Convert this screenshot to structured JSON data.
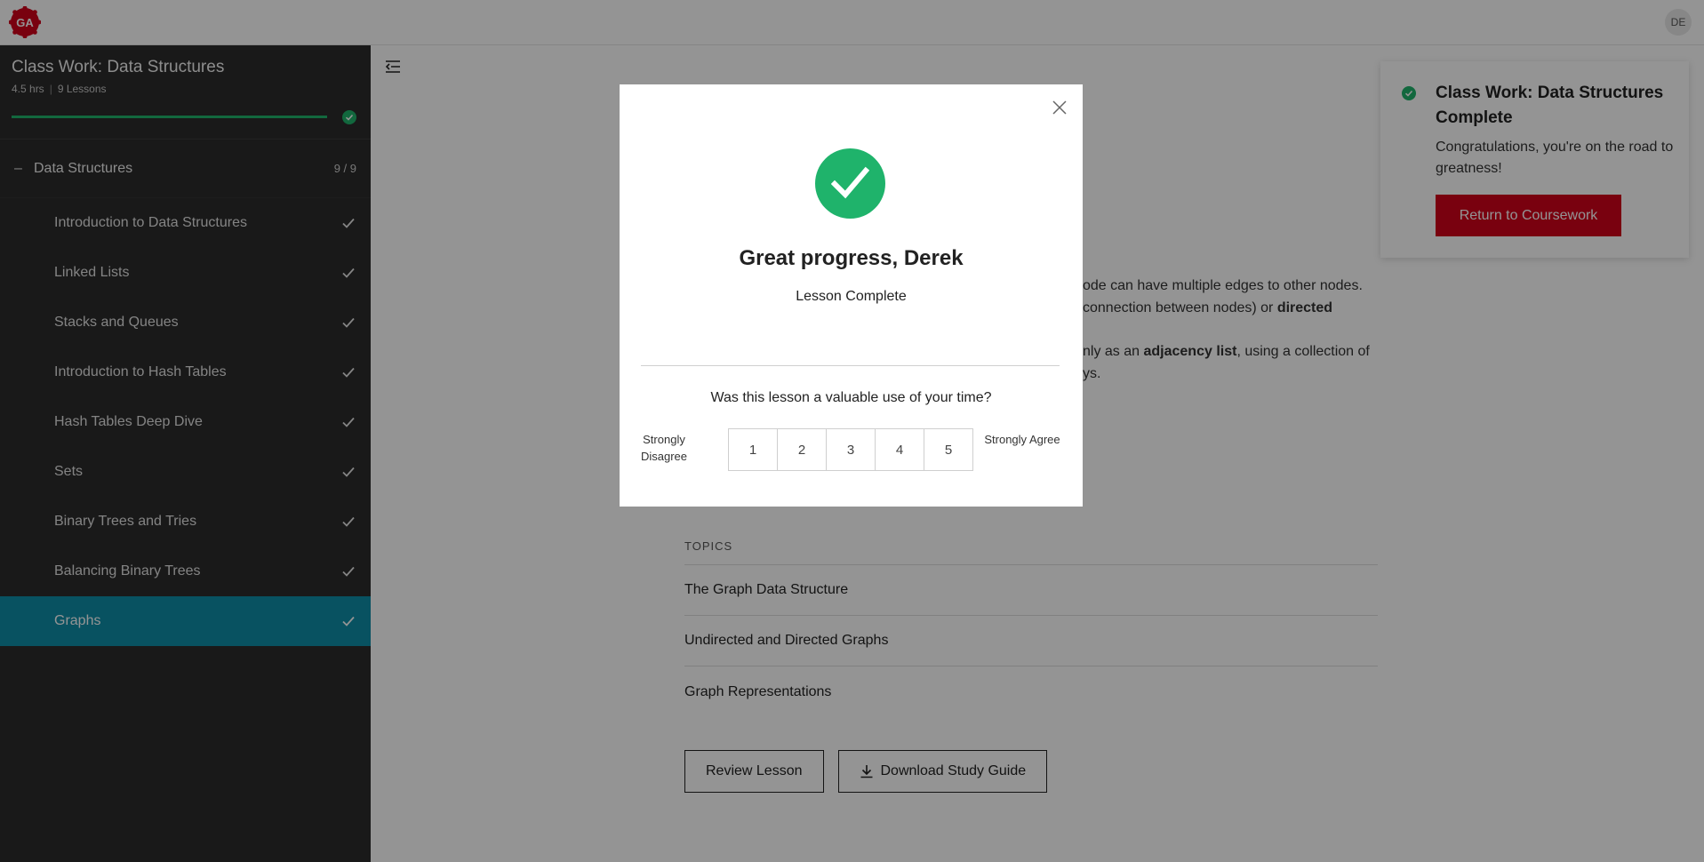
{
  "header": {
    "logo_text": "GA",
    "avatar_initials": "DE"
  },
  "sidebar": {
    "course_title": "Class Work: Data Structures",
    "course_hours": "4.5 hrs",
    "course_lessons": "9 Lessons",
    "progress": 1.0,
    "section": {
      "toggle": "–",
      "label": "Data Structures",
      "count": "9 / 9"
    },
    "lessons": [
      {
        "label": "Introduction to Data Structures",
        "complete": true
      },
      {
        "label": "Linked Lists",
        "complete": true
      },
      {
        "label": "Stacks and Queues",
        "complete": true
      },
      {
        "label": "Introduction to Hash Tables",
        "complete": true
      },
      {
        "label": "Hash Tables Deep Dive",
        "complete": true
      },
      {
        "label": "Sets",
        "complete": true
      },
      {
        "label": "Binary Trees and Tries",
        "complete": true
      },
      {
        "label": "Balancing Binary Trees",
        "complete": true
      },
      {
        "label": "Graphs",
        "complete": true,
        "active": true
      }
    ]
  },
  "main": {
    "partial_text_1a": "ode can have multiple edges to other nodes.",
    "partial_text_1b": "connection between nodes) or ",
    "partial_text_1b_bold": "directed",
    "partial_text_2a_pre": "nly as an ",
    "partial_text_2a_bold": "adjacency list",
    "partial_text_2a_post": ", using a collection of",
    "partial_text_2b": "ys.",
    "topics_title": "TOPICS",
    "topics": [
      "The Graph Data Structure",
      "Undirected and Directed Graphs",
      "Graph Representations"
    ],
    "review_button": "Review Lesson",
    "download_button": "Download Study Guide"
  },
  "toast": {
    "title": "Class Work: Data Structures Complete",
    "message": "Congratulations, you're on the road to greatness!",
    "button": "Return to Coursework"
  },
  "modal": {
    "title": "Great progress, Derek",
    "subtitle": "Lesson Complete",
    "question": "Was this lesson a valuable use of your time?",
    "scale_left": "Strongly Disagree",
    "scale_right": "Strongly Agree",
    "options": [
      "1",
      "2",
      "3",
      "4",
      "5"
    ]
  },
  "colors": {
    "brand_red": "#d0021b",
    "success_green": "#1fb36b",
    "active_teal": "#0e8ea8",
    "sidebar_bg": "#2b2b2b"
  }
}
